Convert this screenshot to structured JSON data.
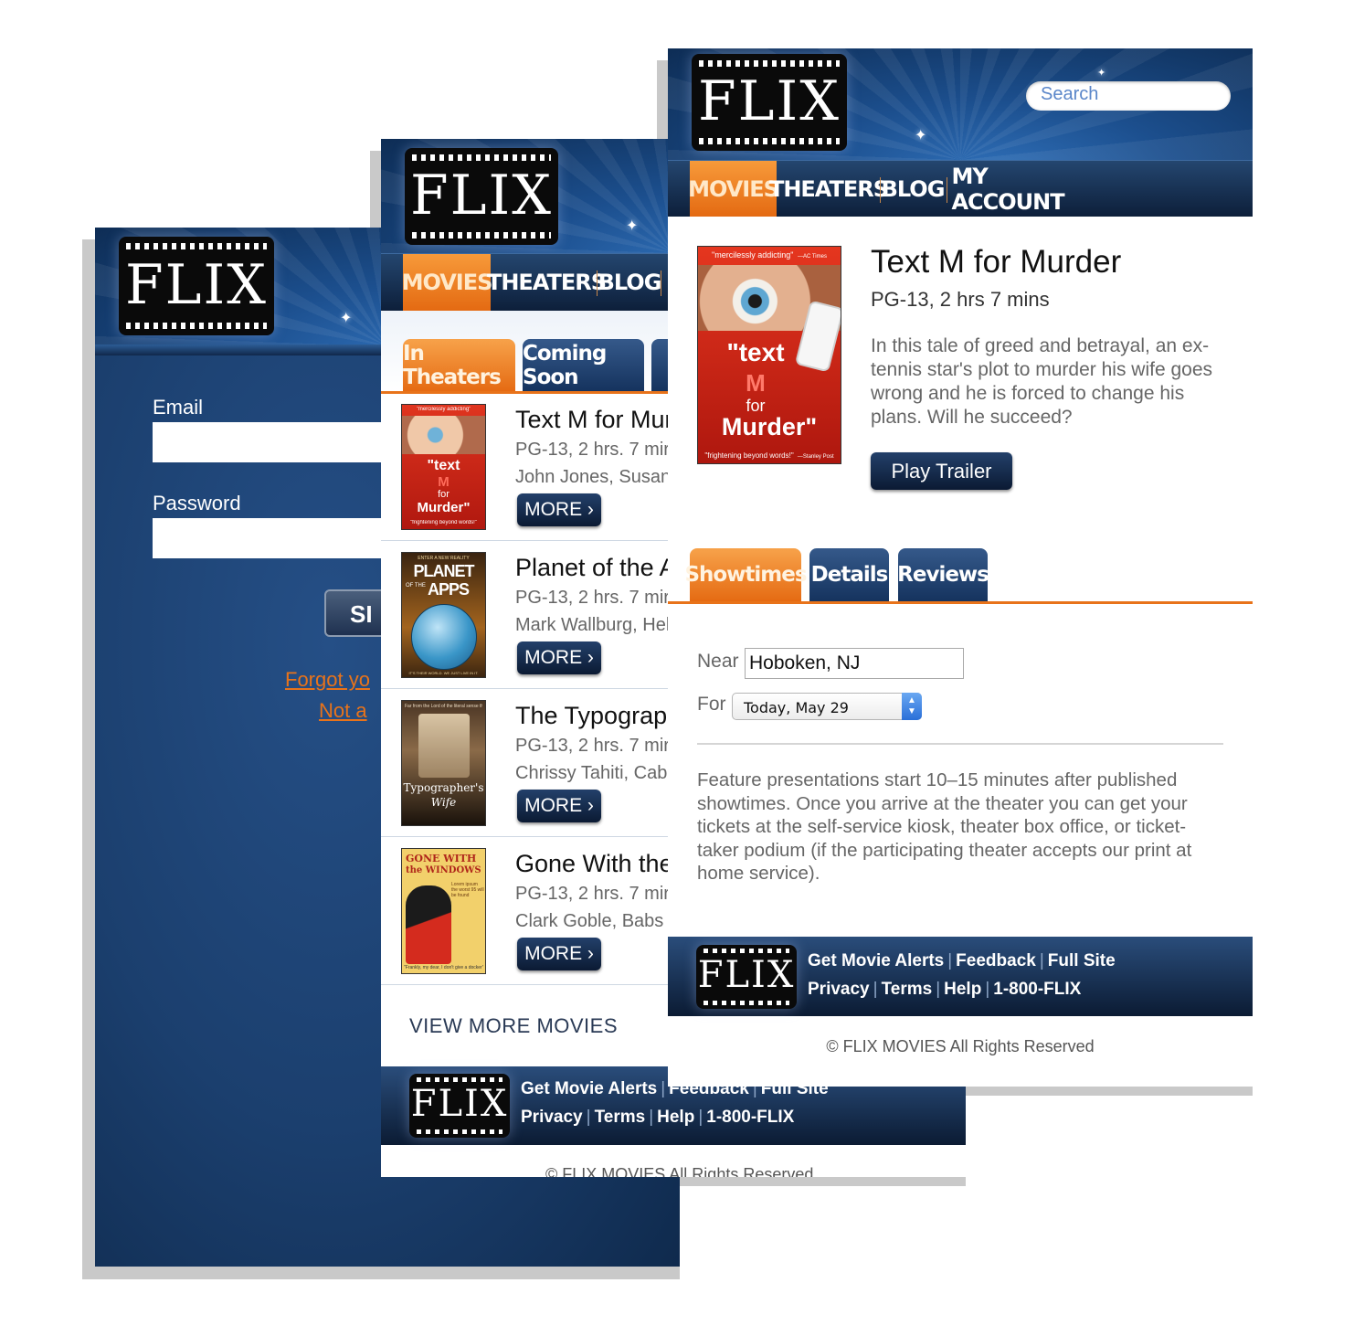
{
  "brand": {
    "logo_text": "FLIX"
  },
  "login": {
    "email_label": "Email",
    "password_label": "Password",
    "signin_label": "SI",
    "forgot_link": "Forgot yo",
    "not_member_link": "Not a"
  },
  "list_screen": {
    "nav": [
      "MOVIES",
      "THEATERS",
      "BLOG"
    ],
    "tabs": [
      "In Theaters",
      "Coming Soon"
    ],
    "movies": [
      {
        "title": "Text M for Murc",
        "meta": "PG-13, 2 hrs. 7 mir",
        "cast": "John Jones, Susan",
        "more": "MORE ›",
        "poster": {
          "quote": "\"mercilessly addicting\"",
          "l1": "\"text",
          "l2": "M",
          "l3": "for",
          "l4": "Murder\"",
          "tag": "\"frightening beyond words!\""
        }
      },
      {
        "title": "Planet of the A",
        "meta": "PG-13, 2 hrs. 7 mir",
        "cast": "Mark Wallburg, Hell",
        "more": "MORE ›",
        "poster": {
          "top": "ENTER A NEW REALITY",
          "l1": "PLANET",
          "l2": "OF THE",
          "l3": "APPS",
          "bottom": "IT'S THEIR WORLD. WE JUST LIVE IN IT."
        }
      },
      {
        "title": "The Typographe",
        "meta": "PG-13, 2 hrs. 7 mir",
        "cast": "Chrissy Tahiti, Cabe",
        "more": "MORE ›",
        "poster": {
          "top": "Far from the Lord of the literal sense this is",
          "l1": "Typographer's",
          "l2": "Wife"
        }
      },
      {
        "title": "Gone With the",
        "meta": "PG-13, 2 hrs. 7 mir",
        "cast": "Clark Goble, Babs C",
        "more": "MORE ›",
        "poster": {
          "l1": "GONE WITH",
          "l2": "the WINDOWS",
          "side": "Lorem ipsum the worst 95 will be found",
          "bottom": "\"Frankly, my dear, I don't give a docker\""
        }
      }
    ],
    "view_more": "VIEW MORE MOVIES",
    "footer": {
      "row1": [
        "Get Movie Alerts",
        "Feedback",
        "Full Site"
      ],
      "row2": [
        "Privacy",
        "Terms",
        "Help",
        "1-800-FLIX"
      ]
    },
    "copyright": "© FLIX MOVIES All Rights Reserved"
  },
  "detail_screen": {
    "search_placeholder": "Search",
    "nav": [
      "MOVIES",
      "THEATERS",
      "BLOG",
      "MY ACCOUNT"
    ],
    "movie": {
      "title": "Text M for Murder",
      "meta": "PG-13, 2 hrs 7 mins",
      "description": "In this tale of greed and betrayal, an ex-tennis star's plot to murder his wife goes wrong and he is forced to change his plans. Will he succeed?",
      "play_trailer": "Play Trailer",
      "poster": {
        "quote": "\"mercilessly addicting\"",
        "quote_src": "—AC Times",
        "l1": "\"text",
        "l2": "M",
        "l3": "for",
        "l4": "Murder\"",
        "tag": "\"frightening beyond words!\"",
        "tag_src": "—Stanley Post"
      }
    },
    "tabs": [
      "Showtimes",
      "Details",
      "Reviews"
    ],
    "near_label": "Near",
    "near_value": "Hoboken, NJ",
    "for_label": "For",
    "for_value": "Today, May 29",
    "note": "Feature presentations start 10–15 minutes after published showtimes. Once you arrive at the theater you can get your tickets at the self-service kiosk, theater box office, or ticket-taker podium (if the participating theater accepts our print at home service).",
    "footer": {
      "row1": [
        "Get Movie Alerts",
        "Feedback",
        "Full Site"
      ],
      "row2": [
        "Privacy",
        "Terms",
        "Help",
        "1-800-FLIX"
      ]
    },
    "copyright": "© FLIX MOVIES All Rights Reserved"
  },
  "colors": {
    "accent": "#e8731a",
    "navy": "#122d52",
    "link_orange": "#e8731a"
  }
}
